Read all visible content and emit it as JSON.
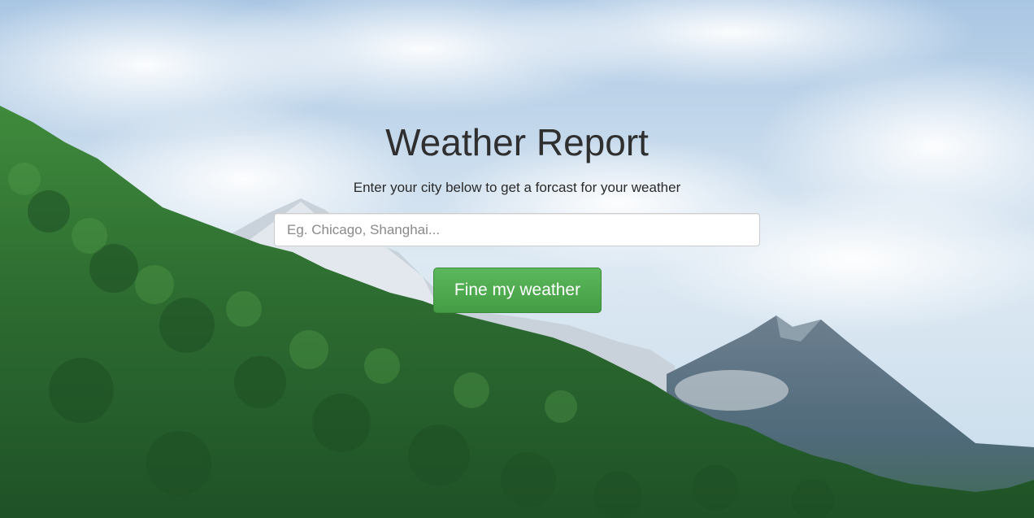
{
  "header": {
    "title": "Weather Report",
    "subtitle": "Enter your city below to get a forcast for your weather"
  },
  "search": {
    "placeholder": "Eg. Chicago, Shanghai...",
    "value": ""
  },
  "actions": {
    "submit_label": "Fine my weather"
  },
  "colors": {
    "button": "#5cb85c",
    "title": "#2f2f2f",
    "sky": "#cfe0ee",
    "forest": "#2e6b32",
    "mountain": "#5b7489"
  }
}
